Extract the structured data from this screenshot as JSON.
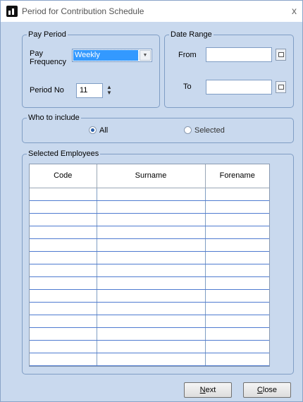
{
  "window": {
    "title": "Period for Contribution Schedule",
    "close_glyph": "x"
  },
  "pay_period": {
    "legend": "Pay Period",
    "frequency_label_1": "Pay",
    "frequency_label_2": "Frequency",
    "frequency_value": "Weekly",
    "period_no_label": "Period No",
    "period_no_value": "11"
  },
  "date_range": {
    "legend": "Date Range",
    "from_label": "From",
    "from_value": "",
    "to_label": "To",
    "to_value": ""
  },
  "who_to_include": {
    "legend": "Who to include",
    "options": [
      {
        "label": "All",
        "checked": true
      },
      {
        "label": "Selected",
        "checked": false
      }
    ]
  },
  "selected_employees": {
    "legend": "Selected Employees",
    "columns": [
      "Code",
      "Surname",
      "Forename"
    ],
    "row_count": 14
  },
  "buttons": {
    "next_mnemonic": "N",
    "next_rest": "ext",
    "close_mnemonic": "C",
    "close_rest": "lose"
  }
}
